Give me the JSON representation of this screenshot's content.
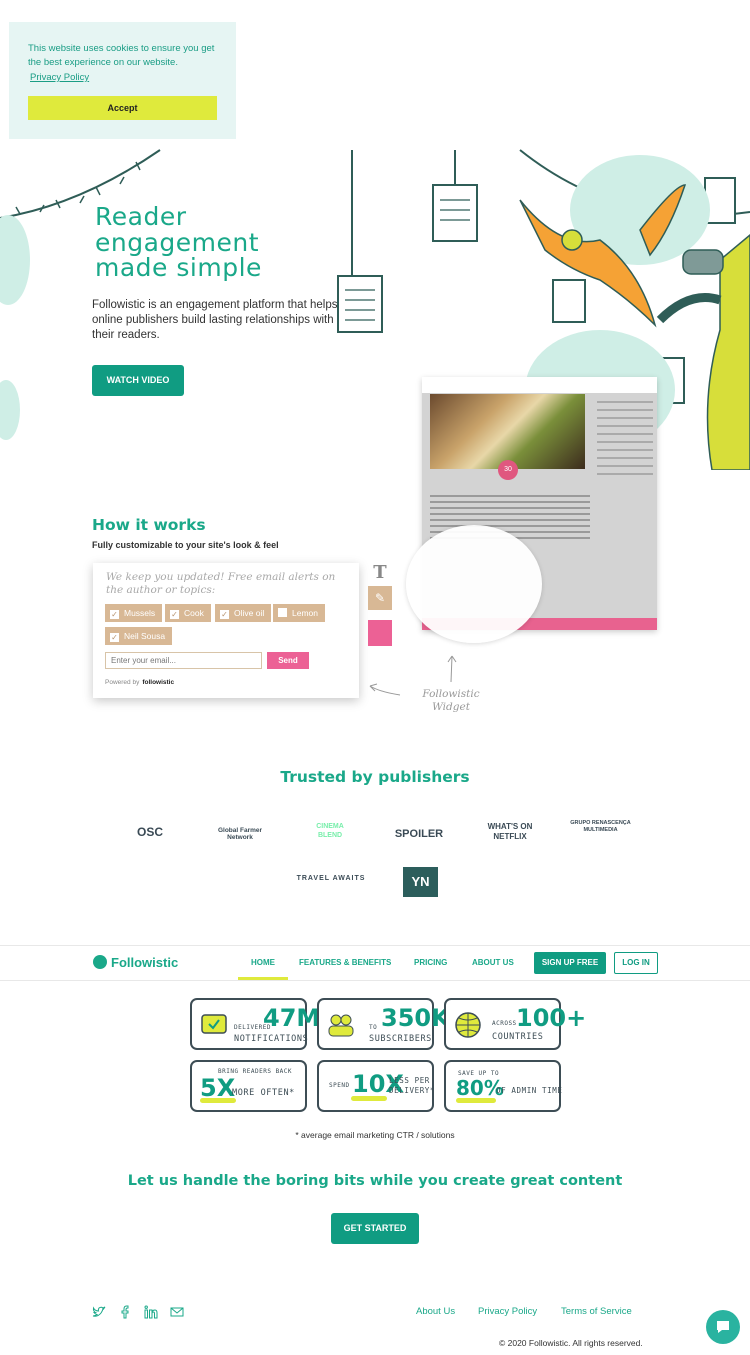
{
  "cookie": {
    "message": "This website uses cookies to ensure you get the best experience on our website.",
    "privacy_link": "Privacy Policy",
    "accept": "Accept"
  },
  "hero": {
    "title": "Reader engagement made simple",
    "description": "Followistic is an engagement platform that helps online publishers build lasting relationships with their readers.",
    "watch_video": "WATCH VIDEO"
  },
  "how": {
    "title": "How it works",
    "subtitle": "Fully customizable to your site's look & feel",
    "widget_title": "We keep you updated! Free email alerts on the author or topics:",
    "chips": [
      "Mussels",
      "Cook",
      "Olive oil",
      "Lemon",
      "Neil Sousa"
    ],
    "email_placeholder": "Enter your email...",
    "send": "Send",
    "powered_by": "Powered by",
    "powered_brand": "followistic",
    "widget_label": "Followistic Widget"
  },
  "trusted": {
    "title": "Trusted by publishers",
    "logos": [
      "OSC",
      "Global Farmer Network",
      "CINEMA BLEND",
      "SPOILER",
      "WHAT'S ON NETFLIX",
      "GRUPO RENASCENÇA MULTIMEDIA",
      "TRAVEL AWAITS",
      "YN"
    ]
  },
  "nav": {
    "brand": "Followistic",
    "items": [
      "HOME",
      "FEATURES & BENEFITS",
      "PRICING",
      "ABOUT US"
    ],
    "signup": "SIGN UP FREE",
    "login": "LOG IN"
  },
  "stats": [
    {
      "pre": "DELIVERED",
      "num": "47M",
      "label": "NOTIFICATIONS"
    },
    {
      "pre": "TO",
      "num": "350K",
      "label": "SUBSCRIBERS"
    },
    {
      "pre": "ACROSS",
      "num": "100+",
      "label": "COUNTRIES"
    },
    {
      "pre": "BRING READERS BACK",
      "num": "5X",
      "label": "MORE OFTEN*"
    },
    {
      "pre": "SPEND",
      "num": "10X",
      "label": "LESS PER DELIVERY*"
    },
    {
      "pre": "SAVE UP TO",
      "num": "80%",
      "label": "OF ADMIN TIME"
    }
  ],
  "footnote": "* average email marketing CTR / solutions",
  "cta": {
    "tagline": "Let us handle the boring bits while you create great content",
    "button": "GET STARTED"
  },
  "footer": {
    "social_icons": [
      "twitter-icon",
      "facebook-icon",
      "linkedin-icon",
      "mail-icon"
    ],
    "links": [
      "About Us",
      "Privacy Policy",
      "Terms of Service"
    ],
    "copyright": "© 2020 Followistic. All rights reserved."
  },
  "colors": {
    "brand": "#1aa889",
    "accent": "#dfea3c",
    "pink": "#ec6195",
    "tan": "#d8b895"
  }
}
